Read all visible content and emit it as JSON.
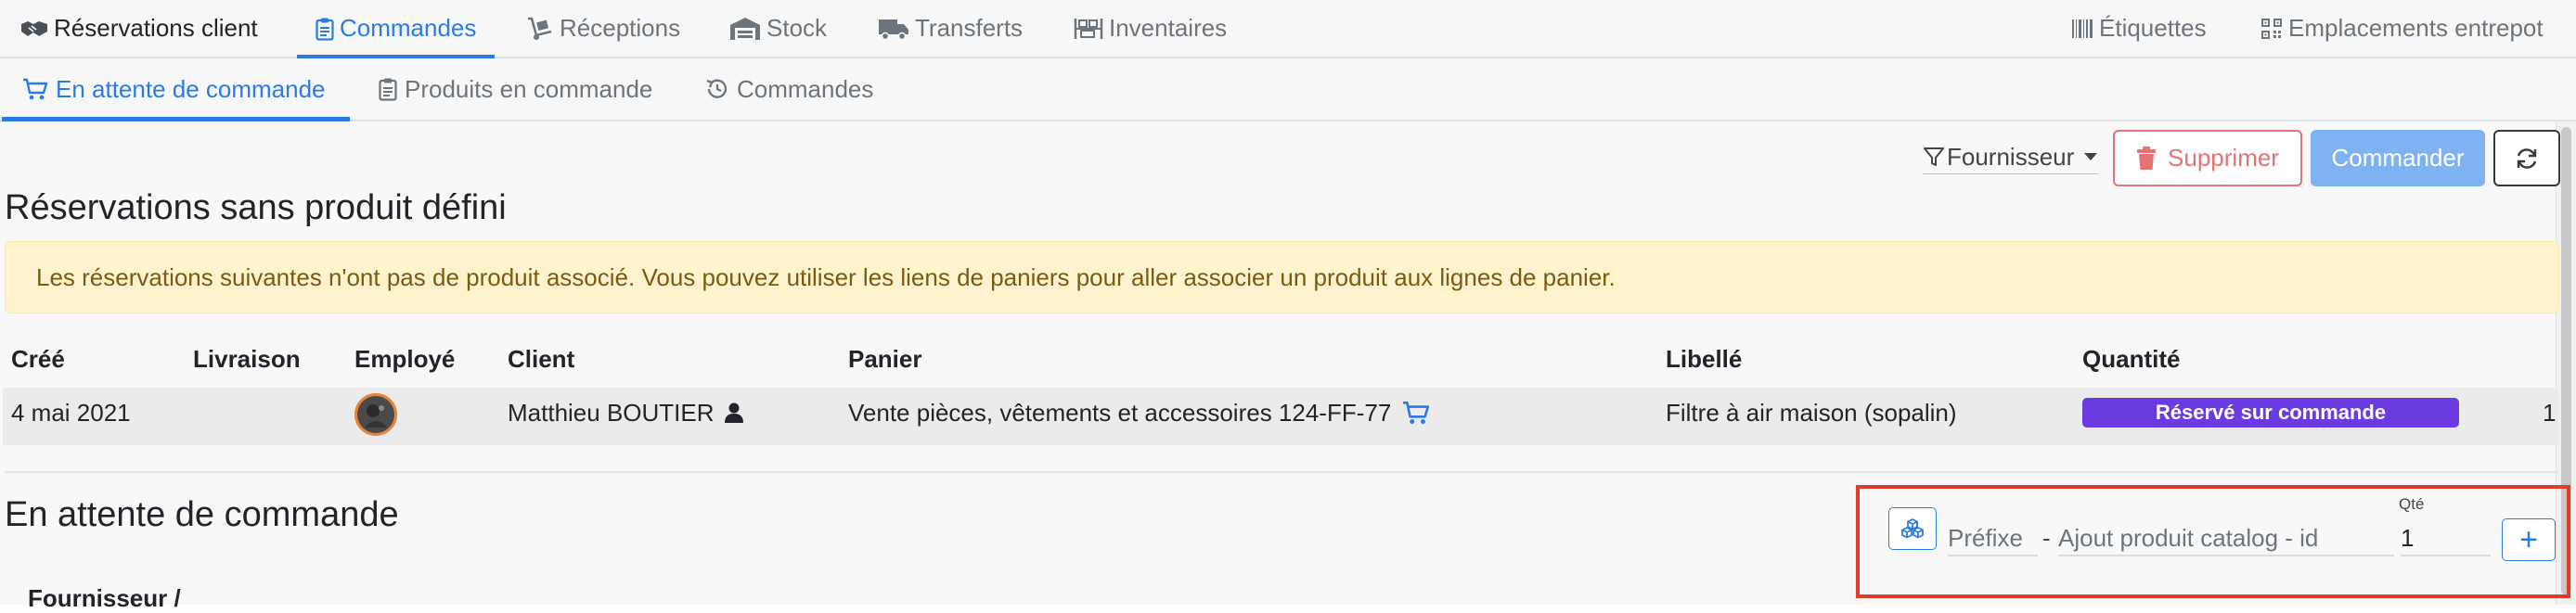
{
  "top_nav": {
    "items": [
      {
        "label": "Réservations client",
        "icon": "handshake-icon"
      },
      {
        "label": "Commandes",
        "icon": "clipboard-icon",
        "active": true
      },
      {
        "label": "Réceptions",
        "icon": "dolly-icon"
      },
      {
        "label": "Stock",
        "icon": "warehouse-icon"
      },
      {
        "label": "Transferts",
        "icon": "truck-icon"
      },
      {
        "label": "Inventaires",
        "icon": "inventory-icon"
      }
    ],
    "right_items": [
      {
        "label": "Étiquettes",
        "icon": "barcode-icon"
      },
      {
        "label": "Emplacements entrepot",
        "icon": "qrcode-icon"
      }
    ]
  },
  "sub_nav": {
    "items": [
      {
        "label": "En attente de commande",
        "icon": "cart-icon",
        "active": true
      },
      {
        "label": "Produits en commande",
        "icon": "clipboard-icon"
      },
      {
        "label": "Commandes",
        "icon": "history-icon"
      }
    ]
  },
  "toolbar": {
    "filter_label": "Fournisseur",
    "delete_label": "Supprimer",
    "order_label": "Commander"
  },
  "section1": {
    "title": "Réservations sans produit défini",
    "alert": "Les réservations suivantes n'ont pas de produit associé. Vous pouvez utiliser les liens de paniers pour aller associer un produit aux lignes de panier.",
    "columns": [
      "Créé",
      "Livraison",
      "Employé",
      "Client",
      "Panier",
      "Libellé",
      "Quantité"
    ],
    "rows": [
      {
        "cree": "4 mai 2021",
        "livraison": "",
        "client": "Matthieu BOUTIER",
        "panier": "Vente pièces, vêtements et accessoires 124-FF-77",
        "libelle": "Filtre à air maison (sopalin)",
        "status": "Réservé sur commande",
        "quantite": "1"
      }
    ]
  },
  "section2": {
    "title": "En attente de commande",
    "prefix_placeholder": "Préfixe",
    "separator": "-",
    "product_placeholder": "Ajout produit catalog - id",
    "qty_label": "Qté",
    "qty_value": "1",
    "add_label": "+",
    "table_header_partial": "Fournisseur /"
  },
  "colors": {
    "accent": "#2c7be5",
    "danger": "#e57373",
    "badge": "#6b3be2",
    "alert_bg": "#fff3cd",
    "highlight": "#e03b2b"
  }
}
